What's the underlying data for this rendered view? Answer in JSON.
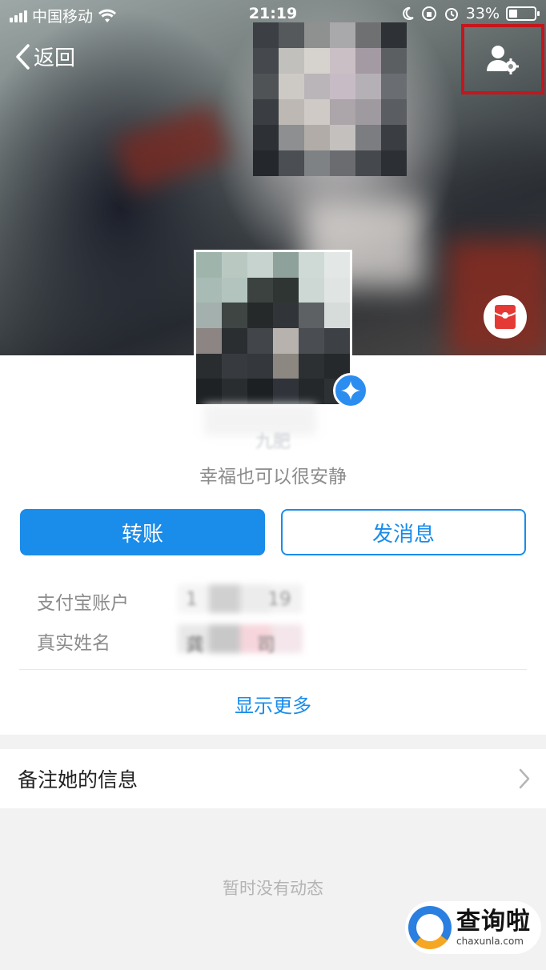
{
  "status_bar": {
    "carrier": "中国移动",
    "time": "21:19",
    "battery": "33%",
    "battery_level": 0.33
  },
  "nav": {
    "back_label": "返回",
    "settings_icon": "user-settings-icon"
  },
  "profile": {
    "nickname": "九肥",
    "signature": "幸福也可以很安静"
  },
  "actions": {
    "transfer": "转账",
    "message": "发消息"
  },
  "info": {
    "account_label": "支付宝账户",
    "account_value": "1            19",
    "name_label": "真实姓名",
    "name_value": "龚         司"
  },
  "show_more": "显示更多",
  "remark": {
    "label": "备注她的信息"
  },
  "feed": {
    "empty": "暂时没有动态"
  },
  "watermark": {
    "name": "查询啦",
    "domain": "chaxunla.com"
  },
  "colors": {
    "accent": "#1a8cea",
    "highlight_box": "#c4161c"
  }
}
